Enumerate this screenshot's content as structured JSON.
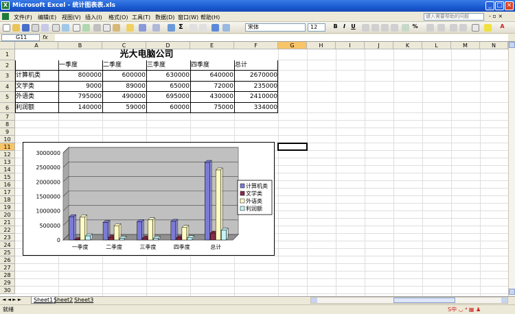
{
  "window": {
    "title": "Microsoft Excel - 统计图表表.xls",
    "minimize_icon": "minimize-icon",
    "maximize_icon": "maximize-icon",
    "close_icon": "close-icon"
  },
  "menu": [
    "文件(F)",
    "编辑(E)",
    "视图(V)",
    "插入(I)",
    "格式(O)",
    "工具(T)",
    "数据(D)",
    "窗口(W)",
    "帮助(H)"
  ],
  "help_placeholder": "键入需要帮助的问题",
  "format": {
    "font": "宋体",
    "size": "12",
    "bold": "B",
    "italic": "I",
    "underline": "U",
    "percent": "%"
  },
  "formula": {
    "cell_ref": "G11",
    "fx": "fx",
    "content": ""
  },
  "columns": [
    "A",
    "B",
    "C",
    "D",
    "E",
    "F",
    "G",
    "H",
    "I",
    "J",
    "K",
    "L",
    "M",
    "N"
  ],
  "rows": [
    "1",
    "2",
    "3",
    "4",
    "5",
    "6",
    "7",
    "8",
    "9",
    "10",
    "11",
    "12",
    "13",
    "14",
    "15",
    "16",
    "17",
    "18",
    "19",
    "20",
    "21",
    "22",
    "23",
    "24",
    "25",
    "26",
    "27",
    "28",
    "29",
    "30"
  ],
  "sheet": {
    "title": "光大电脑公司",
    "headers": [
      "一季度",
      "二季度",
      "三季度",
      "四季度",
      "总计"
    ],
    "data": [
      {
        "label": "计算机类",
        "values": [
          "800000",
          "600000",
          "630000",
          "640000",
          "2670000"
        ]
      },
      {
        "label": "文学类",
        "values": [
          "9000",
          "89000",
          "65000",
          "72000",
          "235000"
        ]
      },
      {
        "label": "外语类",
        "values": [
          "795000",
          "490000",
          "695000",
          "430000",
          "2410000"
        ]
      },
      {
        "label": "利润额",
        "values": [
          "140000",
          "59000",
          "60000",
          "75000",
          "334000"
        ]
      }
    ]
  },
  "chart_data": {
    "type": "bar",
    "categories": [
      "一季度",
      "二季度",
      "三季度",
      "四季度",
      "总计"
    ],
    "series": [
      {
        "name": "计算机类",
        "values": [
          800000,
          600000,
          630000,
          640000,
          2670000
        ],
        "color": "#7b7bd6"
      },
      {
        "name": "文学类",
        "values": [
          9000,
          89000,
          65000,
          72000,
          235000
        ],
        "color": "#8a2a4a"
      },
      {
        "name": "外语类",
        "values": [
          795000,
          490000,
          695000,
          430000,
          2410000
        ],
        "color": "#fffcc4"
      },
      {
        "name": "利润额",
        "values": [
          140000,
          59000,
          60000,
          75000,
          334000
        ],
        "color": "#c4f4f8"
      }
    ],
    "ylim": [
      0,
      3000000
    ],
    "yticks": [
      "0",
      "500000",
      "1000000",
      "1500000",
      "2000000",
      "2500000",
      "3000000"
    ],
    "legend": "right",
    "grid": true,
    "plot_bg": "#c0c0c0"
  },
  "tabs": {
    "nav": "◄ ◄ ► ►",
    "sheets": [
      "Sheet1",
      "Sheet2",
      "Sheet3"
    ]
  },
  "status": "就绪"
}
